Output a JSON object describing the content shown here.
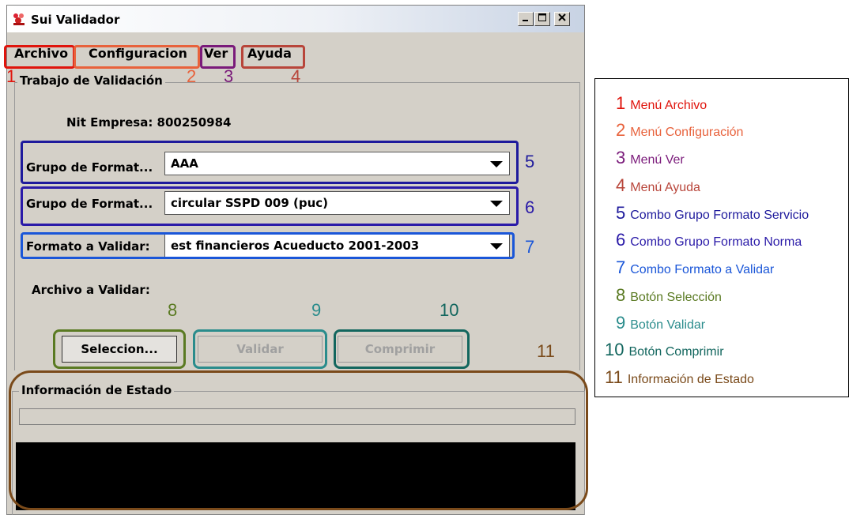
{
  "window": {
    "title": "Sui Validador"
  },
  "menu": {
    "archivo": "Archivo",
    "configuracion": "Configuracion",
    "ver": "Ver",
    "ayuda": "Ayuda"
  },
  "trabajo": {
    "legend": "Trabajo de Validación",
    "nit_label": "Nit Empresa: 800250984",
    "grupo_servicio_label": "Grupo de Format...",
    "grupo_servicio_value": "AAA",
    "grupo_norma_label": "Grupo de Format...",
    "grupo_norma_value": "circular SSPD 009 (puc)",
    "formato_label": "Formato a Validar:",
    "formato_value": "est financieros Acueducto 2001-2003",
    "archivo_label": "Archivo a Validar:",
    "seleccion_button": "Seleccion...",
    "validar_button": "Validar",
    "comprimir_button": "Comprimir"
  },
  "estado": {
    "legend": "Información de Estado"
  },
  "callouts": [
    "1",
    "2",
    "3",
    "4",
    "5",
    "6",
    "7",
    "8",
    "9",
    "10",
    "11"
  ],
  "legend_items": [
    {
      "num": "1",
      "text": "Menú Archivo",
      "color": "#e0140c"
    },
    {
      "num": "2",
      "text": "Menú Configuración",
      "color": "#e8623c"
    },
    {
      "num": "3",
      "text": "Menú Ver",
      "color": "#7a1a7a"
    },
    {
      "num": "4",
      "text": "Menú Ayuda",
      "color": "#b8453a"
    },
    {
      "num": "5",
      "text": "Combo Grupo Formato Servicio",
      "color": "#1e1a9c"
    },
    {
      "num": "6",
      "text": "Combo Grupo Formato Norma",
      "color": "#2a1aa8"
    },
    {
      "num": "7",
      "text": "Combo Formato a Validar",
      "color": "#1a56d8"
    },
    {
      "num": "8",
      "text": "Botón Selección",
      "color": "#5a7a22"
    },
    {
      "num": "9",
      "text": "Botón Validar",
      "color": "#2a8c8c"
    },
    {
      "num": "10",
      "text": "Botón Comprimir",
      "color": "#12665e"
    },
    {
      "num": "11",
      "text": "Información de Estado",
      "color": "#7a4a1a"
    }
  ],
  "colors": {
    "archivo": "#e0140c",
    "configuracion": "#e8623c",
    "ver": "#7a1a7a",
    "ayuda": "#b8453a",
    "combo_servicio": "#1e1a9c",
    "combo_norma": "#2a1aa8",
    "combo_formato": "#1a56d8",
    "seleccion": "#5a7a22",
    "validar": "#2a8c8c",
    "comprimir": "#12665e",
    "estado": "#7a4a1a"
  },
  "icons": {
    "app": "app-icon",
    "minimize": "minimize-icon",
    "maximize": "maximize-icon",
    "close": "close-icon",
    "dropdown": "chevron-down-icon"
  }
}
